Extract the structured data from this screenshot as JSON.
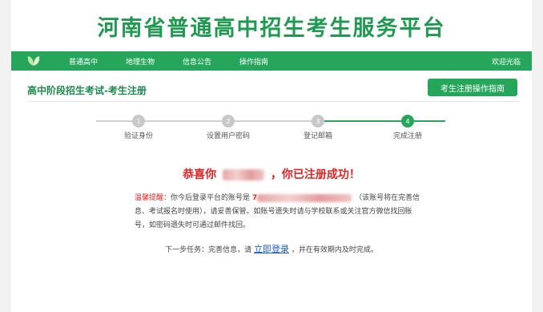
{
  "banner": {
    "title": "河南省普通高中招生考生服务平台"
  },
  "nav": {
    "items": [
      "普通高中",
      "地理生物",
      "信息公告",
      "操作指南"
    ],
    "welcome": "欢迎光临",
    "logo_icon": "leaf-logo-icon"
  },
  "page": {
    "heading": "高中阶段招生考试-考生注册",
    "guide_button": "考生注册操作指南"
  },
  "steps": [
    {
      "number": "1",
      "label": "验证身份",
      "completed": true
    },
    {
      "number": "2",
      "label": "设置用户密码",
      "completed": true
    },
    {
      "number": "3",
      "label": "登记邮箱",
      "completed": true
    },
    {
      "number": "4",
      "label": "完成注册",
      "completed": true,
      "current": true
    }
  ],
  "success": {
    "prefix": "恭喜你",
    "suffix": "，你已注册成功！"
  },
  "notice": {
    "label": "温馨提醒：",
    "text_1": "你今后登录平台的账号是",
    "account_visible": "7",
    "text_2": "（该账号将在完善信息、考试报名时使用），请妥善保管。如账号遗失时请与学校联系或关注官方微信找回账号，如密码遗失时可通过邮件找回。"
  },
  "next_task": {
    "prefix": "下一步任务：完善信息，请",
    "link": "立即登录",
    "suffix": "，并在有效期内及时完成。"
  },
  "colors": {
    "brand_green": "#26a65b",
    "title_green": "#1e9a51",
    "success_red": "#e02424",
    "link_blue": "#1a5bd6"
  }
}
